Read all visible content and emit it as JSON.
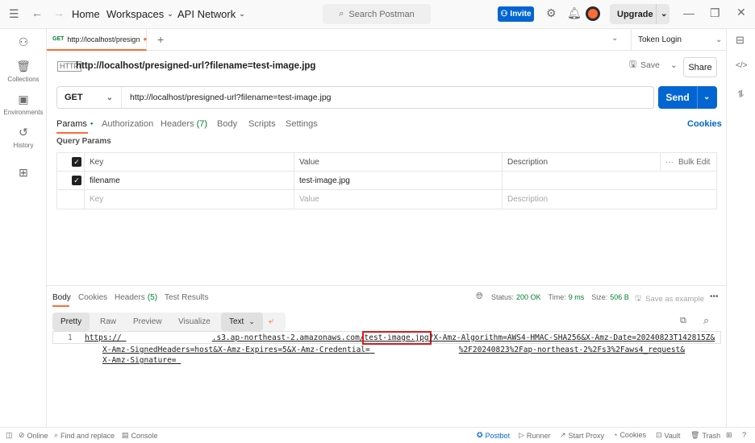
{
  "titlebar": {
    "nav": [
      "Home",
      "Workspaces",
      "API Network"
    ],
    "search_placeholder": "Search Postman",
    "invite": "Invite",
    "upgrade": "Upgrade"
  },
  "leftbar": {
    "items": [
      "",
      "Collections",
      "Environments",
      "History",
      ""
    ]
  },
  "tab": {
    "method": "GET",
    "label": "http://localhost/presign",
    "environment": "Token Login"
  },
  "request": {
    "name": "http://localhost/presigned-url?filename=test-image.jpg",
    "save": "Save",
    "share": "Share",
    "method": "GET",
    "url": "http://localhost/presigned-url?filename=test-image.jpg",
    "send": "Send"
  },
  "request_tabs": {
    "params": "Params",
    "authorization": "Authorization",
    "headers": "Headers",
    "headers_count": "(7)",
    "body": "Body",
    "scripts": "Scripts",
    "settings": "Settings",
    "cookies": "Cookies"
  },
  "query_params": {
    "title": "Query Params",
    "headers": {
      "key": "Key",
      "value": "Value",
      "description": "Description",
      "bulk_edit": "Bulk Edit"
    },
    "rows": [
      {
        "key": "filename",
        "value": "test-image.jpg",
        "description": ""
      }
    ],
    "placeholder": {
      "key": "Key",
      "value": "Value",
      "description": "Description"
    }
  },
  "response": {
    "tabs": {
      "body": "Body",
      "cookies": "Cookies",
      "headers": "Headers",
      "headers_count": "(5)",
      "test_results": "Test Results"
    },
    "status_label": "Status:",
    "status": "200 OK",
    "time_label": "Time:",
    "time": "9 ms",
    "size_label": "Size:",
    "size": "506 B",
    "save_example": "Save as example",
    "formats": [
      "Pretty",
      "Raw",
      "Preview",
      "Visualize"
    ],
    "text_format": "Text",
    "line_number": "1",
    "lines": {
      "l1a": "https://",
      "l1b": ".s3.ap-northeast-2.amazonaws.com/",
      "l1c": "test-image.jpg",
      "l1d": "?X-Amz-Algorithm=AWS4-HMAC-SHA256&X-Amz-Date=20240823T142815Z&",
      "l2a": "X-Amz-SignedHeaders=host&X-Amz-Expires=5&X-Amz-Credential=",
      "l2b": "%2F20240823%2Fap-northeast-2%2Fs3%2Faws4_request&",
      "l3": "X-Amz-Signature="
    },
    "highlight_color": "#d8191b"
  },
  "statusbar": {
    "online": "Online",
    "find_replace": "Find and replace",
    "console": "Console",
    "postbot": "Postbot",
    "runner": "Runner",
    "start_proxy": "Start Proxy",
    "cookies": "Cookies",
    "vault": "Vault",
    "trash": "Trash"
  }
}
